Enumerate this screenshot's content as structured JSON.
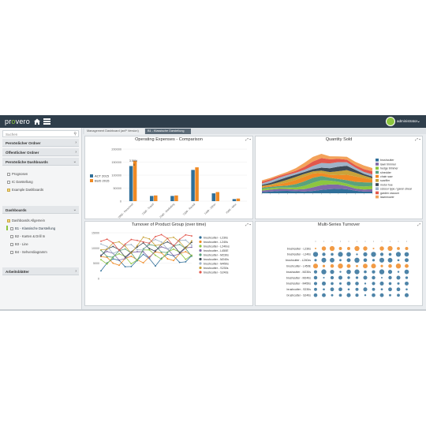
{
  "app": {
    "logo_prefix": "pr",
    "logo_o": "o",
    "logo_suffix": "vero",
    "user": "administrator"
  },
  "sidebar": {
    "search_placeholder": "Suchen",
    "sections": [
      {
        "label": "Persönlicher Ordner"
      },
      {
        "label": "Öffentlicher Ordner"
      },
      {
        "label": "Persönliche Dashboards"
      },
      {
        "label": "Dashboards"
      },
      {
        "label": "Arbeitsblätter"
      }
    ],
    "personal_items": [
      "Prognosen",
      "IC Darstellung",
      "Example Dashboards"
    ],
    "dashboard_items": [
      "Dashboards Allgemein",
      "B1 - Klassische Darstellung",
      "B2 - Karten & Drill In",
      "B3 - Line",
      "B4 - Sehverdiagramm"
    ]
  },
  "tabs": [
    "Management Dashboard (anP Version)",
    "B1 - Klassische Darstellung"
  ],
  "panels": {
    "opex": {
      "title": "Operating Expenses - Comparison"
    },
    "qty": {
      "title": "Quantity Sold"
    },
    "turnover": {
      "title": "Turnover of Product Group (over time)"
    },
    "multi": {
      "title": "Multi-Series Turnover"
    }
  },
  "chart_data": [
    {
      "type": "bar",
      "title": "Operating Expenses - Comparison",
      "categories": [
        "7000 - Personnel",
        "7100 - Travel",
        "7200 - Marketing",
        "7300 - Rental",
        "7400 - Other",
        "7500 - Misc"
      ],
      "series": [
        {
          "name": "ACT 2015",
          "color": "#2f6f99",
          "values": [
            135000,
            20000,
            20000,
            120000,
            30000,
            8000
          ]
        },
        {
          "name": "BUD 2015",
          "color": "#f08a24",
          "values": [
            155000,
            22000,
            22000,
            130000,
            35000,
            10000
          ]
        }
      ],
      "ylim": [
        0,
        200000
      ],
      "yticks": [
        "0",
        "50000",
        "100000",
        "150000",
        "200000"
      ],
      "annotations": [
        "3.59%",
        "6"
      ],
      "legend": "left"
    },
    {
      "type": "area",
      "title": "Quantity Sold",
      "legend_entries": [
        "brushcutter",
        "lawn trimmer",
        "hedge trimmer",
        "shredder",
        "chain saw",
        "scarifier",
        "motor hoe",
        "scissor type / garen shear",
        "garden vacuum",
        "lawnmower"
      ],
      "colors": [
        "#2f6f99",
        "#7f6aa8",
        "#8dc63f",
        "#5aa27c",
        "#f08a24",
        "#c9a33a",
        "#3d4a56",
        "#9fb3c8",
        "#e2574c",
        "#f3a25a"
      ],
      "legend": "right"
    },
    {
      "type": "line",
      "title": "Turnover of Product Group (over time)",
      "ylim": [
        0,
        15000
      ],
      "yticks": [
        "0",
        "5000",
        "10000",
        "15000"
      ],
      "series_names": [
        "brushcutter - L230s",
        "brushcutter - L240s",
        "brushcutter - L240xs",
        "brushcutter - L450E",
        "brushcutter - M230s",
        "brushcutter - M240s",
        "brushcutter - M450s",
        "brushcutter - S230s",
        "brushcutter - S240s"
      ],
      "colors": [
        "#2f6f99",
        "#f08a24",
        "#8dc63f",
        "#7f6aa8",
        "#5aa27c",
        "#3d4a56",
        "#9fb3c8",
        "#c9a33a",
        "#e2574c"
      ],
      "legend": "right"
    },
    {
      "type": "scatter",
      "title": "Multi-Series Turnover",
      "rows": [
        "brushcutter - L230s",
        "brushcutter - L240s",
        "brushcutter - L240xs",
        "brushcutter - L450E",
        "brushcutter - M230s",
        "brushcutter - M240s",
        "brushcutter - M450s",
        "brushcutter - S230s",
        "brushcutter - S240s"
      ],
      "columns": 12
    }
  ]
}
